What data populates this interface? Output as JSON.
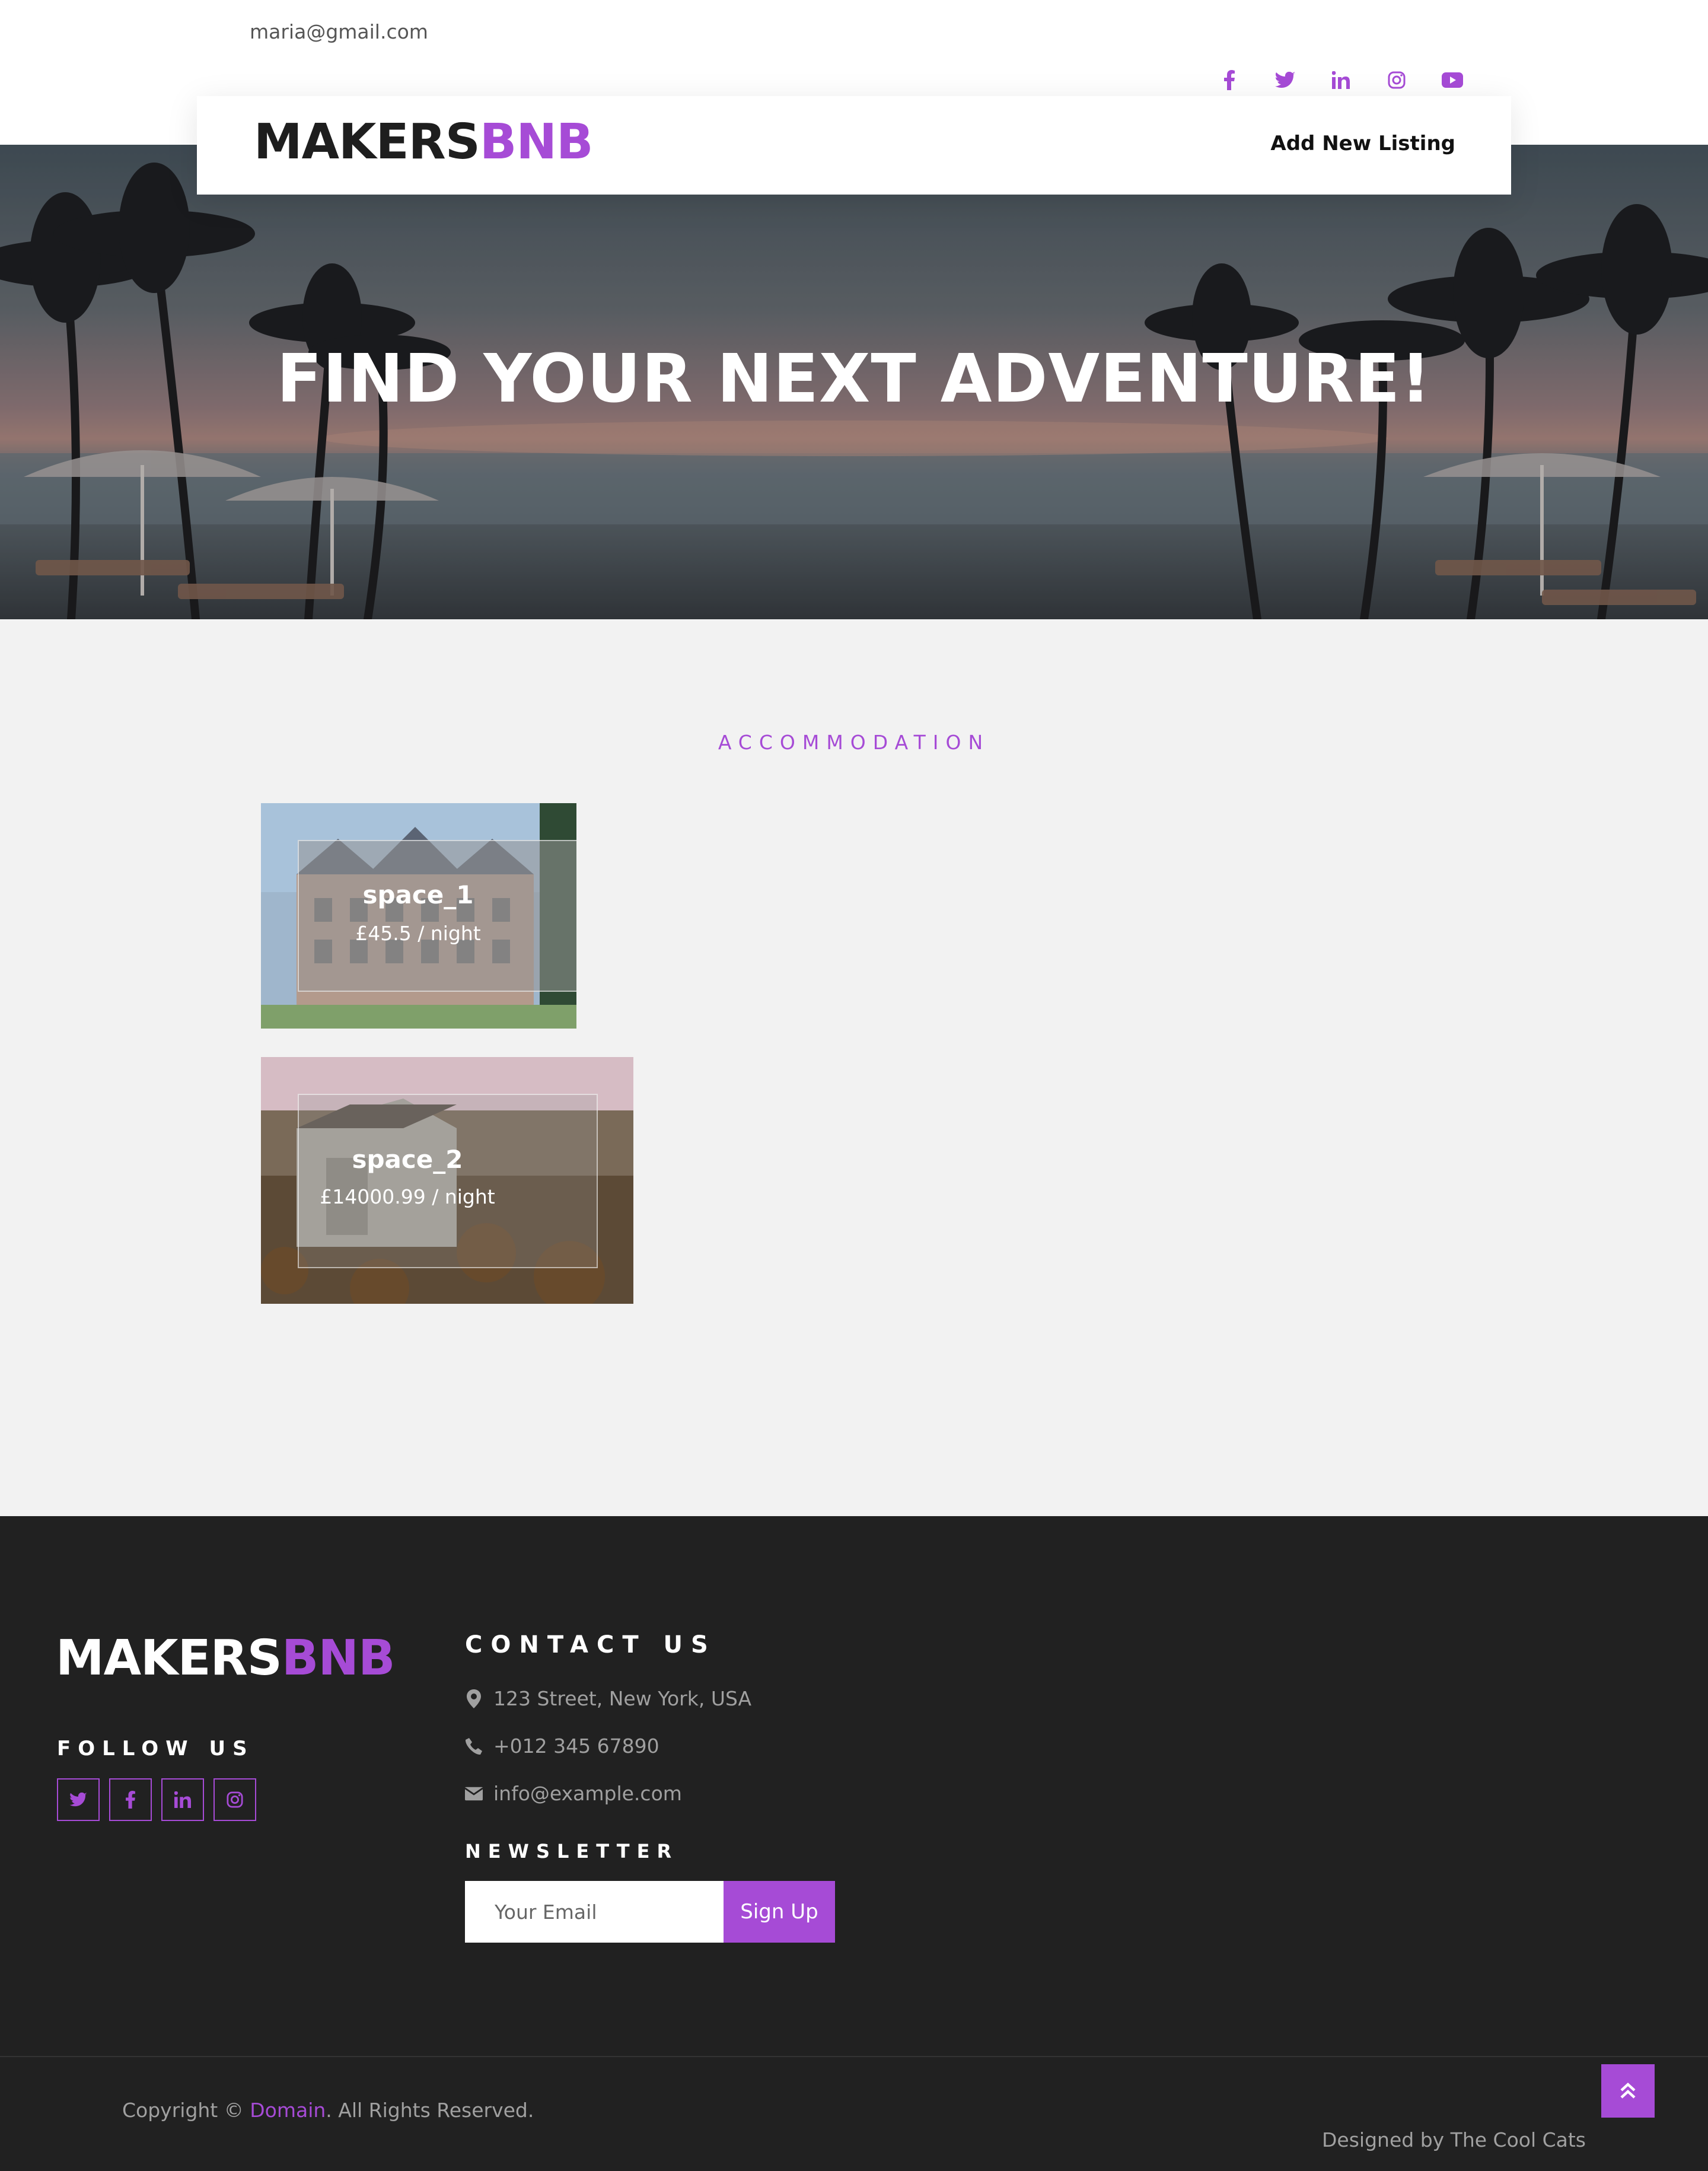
{
  "header": {
    "user_email": "maria@gmail.com",
    "social_icons": [
      "facebook-icon",
      "twitter-icon",
      "linkedin-icon",
      "instagram-icon",
      "youtube-icon"
    ],
    "brand_part1": "MAKERS",
    "brand_part2": "BNB",
    "add_listing": "Add New Listing"
  },
  "hero": {
    "title": "FIND YOUR NEXT ADVENTURE!"
  },
  "accommodation": {
    "section_title": "ACCOMMODATION",
    "listings": [
      {
        "name": "space_1",
        "price": "£45.5 / night"
      },
      {
        "name": "space_2",
        "price": "£14000.99 / night"
      }
    ]
  },
  "footer": {
    "brand_part1": "MAKERS",
    "brand_part2": "BNB",
    "follow_us": "FOLLOW US",
    "contact_us": "CONTACT US",
    "address": "123 Street, New York, USA",
    "phone": "+012 345 67890",
    "email": "info@example.com",
    "newsletter": "NEWSLETTER",
    "newsletter_placeholder": "Your Email",
    "signup": "Sign Up",
    "copyright_prefix": "Copyright © ",
    "copyright_link": "Domain",
    "copyright_suffix": ". All Rights Reserved.",
    "designed_by": "Designed by The Cool Cats"
  },
  "colors": {
    "accent": "#a64bd6",
    "footer_bg": "#212121",
    "page_bg": "#f2f2f2"
  }
}
